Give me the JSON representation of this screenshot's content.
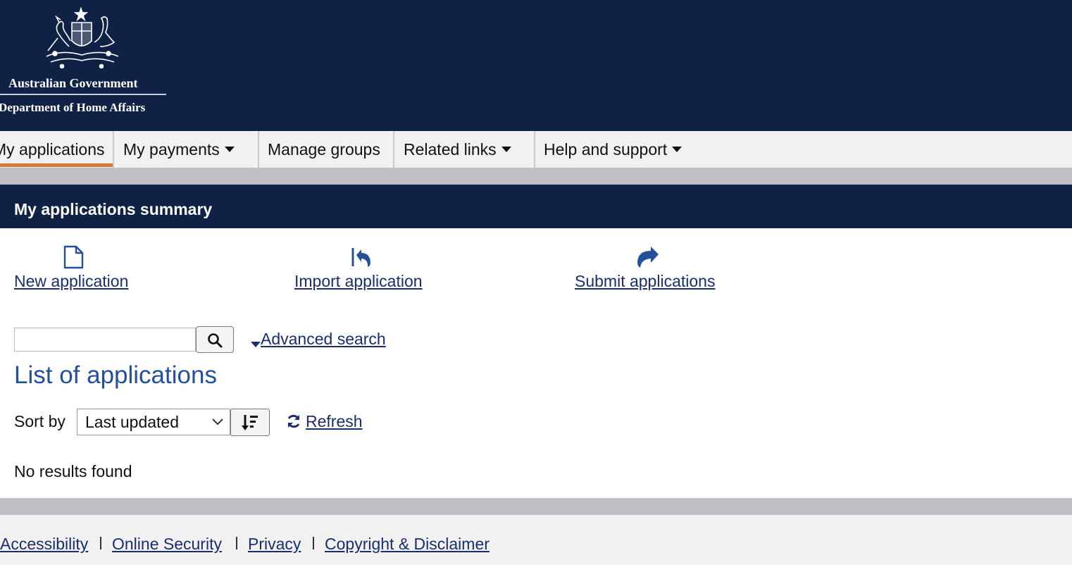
{
  "header": {
    "government": "Australian Government",
    "department": "Department of Home Affairs",
    "logo_icon": "coat-of-arms-icon"
  },
  "nav": {
    "items": [
      {
        "label": "My applications",
        "active": true,
        "has_dropdown": false
      },
      {
        "label": "My payments",
        "has_dropdown": true
      },
      {
        "label": "Manage groups",
        "has_dropdown": false
      },
      {
        "label": "Related links",
        "has_dropdown": true
      },
      {
        "label": "Help and support",
        "has_dropdown": true
      }
    ],
    "active_color": "#d9773a"
  },
  "summary": {
    "title": "My applications summary"
  },
  "actions": [
    {
      "label": "New application",
      "icon": "new-document-icon"
    },
    {
      "label": "Import application",
      "icon": "import-arrow-icon"
    },
    {
      "label": "Submit applications",
      "icon": "submit-arrow-icon"
    }
  ],
  "search": {
    "value": "",
    "button_icon": "search-icon",
    "advanced_label": "Advanced search"
  },
  "list": {
    "title": "List of applications",
    "sort_label": "Sort by",
    "sort_value": "Last updated",
    "sort_order_icon": "sort-descending-icon",
    "refresh_label": "Refresh",
    "refresh_icon": "refresh-icon",
    "empty_message": "No results found"
  },
  "footer": {
    "links": [
      "Accessibility",
      "Online Security",
      "Privacy",
      "Copyright & Disclaimer"
    ]
  },
  "colors": {
    "header_bg": "#0f2145",
    "link": "#1a2e6e",
    "list_title": "#24509b",
    "band": "#bfc0c6"
  }
}
